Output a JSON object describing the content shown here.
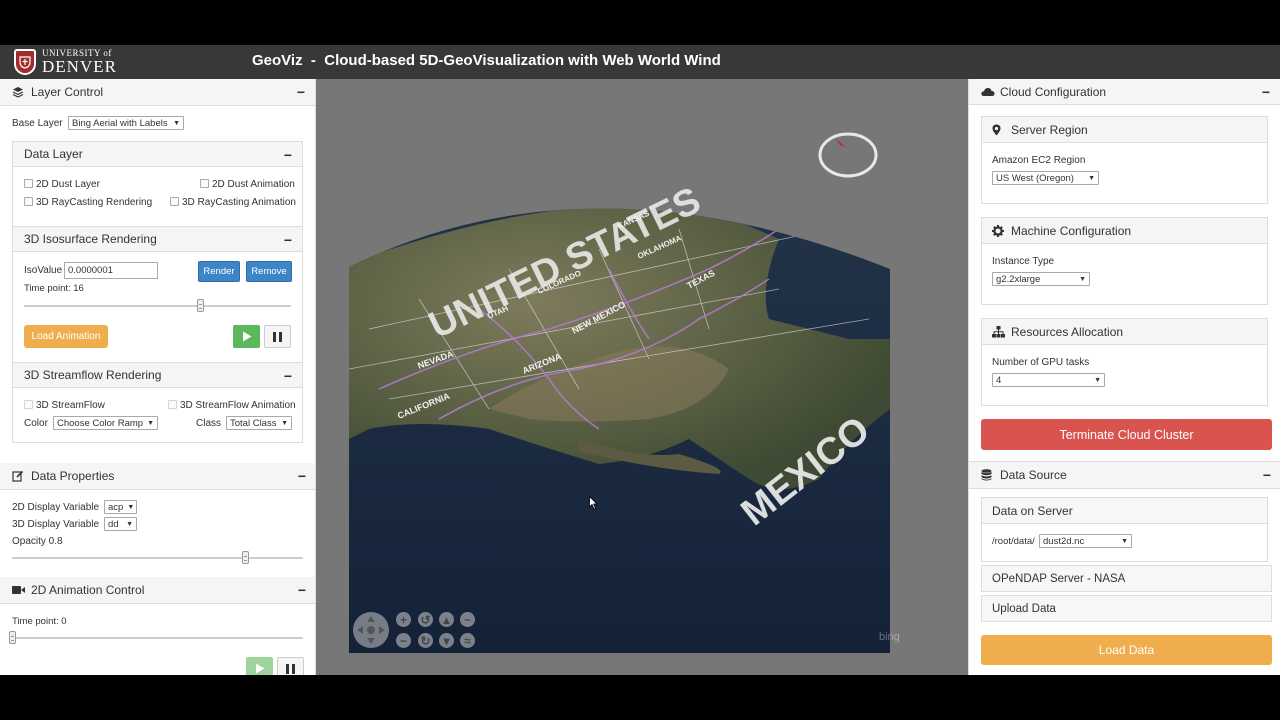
{
  "header": {
    "logo_line1": "UNIVERSITY of",
    "logo_line2": "DENVER",
    "title": "GeoViz  -  Cloud-based 5D-GeoVisualization with Web World Wind"
  },
  "layer_control": {
    "title": "Layer Control",
    "base_layer_label": "Base Layer",
    "base_layer_value": "Bing Aerial with Labels",
    "data_layer": {
      "title": "Data Layer",
      "options": [
        "2D Dust Layer",
        "2D Dust Animation",
        "3D RayCasting Rendering",
        "3D RayCasting Animation"
      ]
    },
    "isosurface": {
      "title": "3D Isosurface Rendering",
      "isovalue_label": "IsoValue",
      "isovalue": "0.0000001",
      "render_label": "Render",
      "remove_label": "Remove",
      "time_point_text": "Time point: 16",
      "time_point_fraction": 0.66,
      "load_animation_label": "Load Animation"
    },
    "streamflow": {
      "title": "3D Streamflow Rendering",
      "option1": "3D StreamFlow",
      "option2": "3D StreamFlow Animation",
      "color_label": "Color",
      "color_value": "Choose Color Ramp",
      "class_label": "Class",
      "class_value": "Total Class"
    }
  },
  "data_properties": {
    "title": "Data Properties",
    "var2d_label": "2D Display Variable",
    "var2d_value": "acp",
    "var3d_label": "3D Display Variable",
    "var3d_value": "dd",
    "opacity_text": "Opacity 0.8",
    "opacity_fraction": 0.8
  },
  "animation_2d": {
    "title": "2D Animation Control",
    "time_point_text": "Time point: 0",
    "time_point_fraction": 0.0
  },
  "globe": {
    "labels": [
      "UNITED STATES",
      "MEXICO",
      "NEVADA",
      "ARIZONA",
      "NEW MEXICO",
      "TEXAS",
      "CALIFORNIA",
      "UTAH",
      "COLORADO",
      "OKLAHOMA",
      "KANSAS"
    ],
    "attribution": "bing"
  },
  "cloud_config": {
    "title": "Cloud Configuration",
    "server_region": {
      "title": "Server Region",
      "label": "Amazon EC2 Region",
      "value": "US West (Oregon)"
    },
    "machine": {
      "title": "Machine Configuration",
      "label": "Instance Type",
      "value": "g2.2xlarge"
    },
    "resources": {
      "title": "Resources Allocation",
      "label": "Number of GPU tasks",
      "value": "4"
    },
    "terminate_label": "Terminate Cloud Cluster"
  },
  "data_source": {
    "title": "Data Source",
    "server_title": "Data on Server",
    "path_label": "/root/data/",
    "file_value": "dust2d.nc",
    "opendap_label": "OPeNDAP Server - NASA",
    "upload_label": "Upload Data",
    "load_label": "Load Data"
  },
  "colors": {
    "header_bg": "#383838",
    "primary": "#3d85c6",
    "warning": "#f0ad4e",
    "danger": "#d9534f",
    "success": "#5cb85c"
  }
}
